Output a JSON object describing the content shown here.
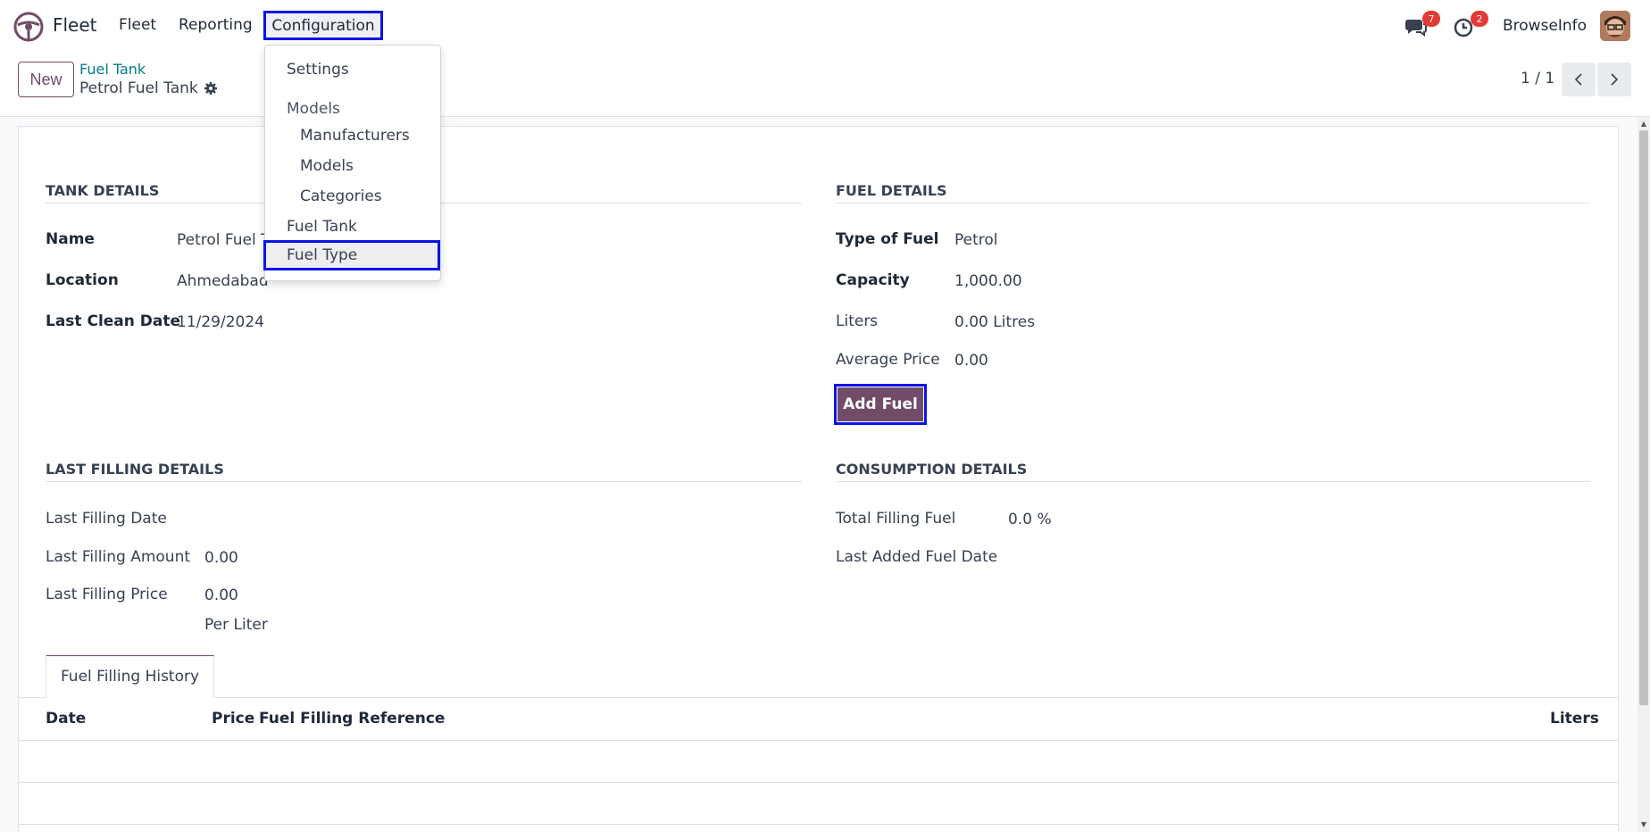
{
  "navbar": {
    "app_name": "Fleet",
    "menu": [
      "Fleet",
      "Reporting",
      "Configuration"
    ],
    "messages_count": "7",
    "activities_count": "2",
    "company": "BrowseInfo"
  },
  "control_panel": {
    "new_label": "New",
    "breadcrumb_parent": "Fuel Tank",
    "breadcrumb_current": "Petrol Fuel Tank",
    "pager": "1 / 1"
  },
  "config_menu": {
    "settings": "Settings",
    "models_header": "Models",
    "manufacturers": "Manufacturers",
    "models": "Models",
    "categories": "Categories",
    "fuel_tank": "Fuel Tank",
    "fuel_type": "Fuel Type"
  },
  "tank_details": {
    "title": "TANK DETAILS",
    "name_label": "Name",
    "name_value": "Petrol Fuel T",
    "location_label": "Location",
    "location_value": "Ahmedabad",
    "clean_label": "Last Clean Date",
    "clean_value": "11/29/2024"
  },
  "fuel_details": {
    "title": "FUEL DETAILS",
    "type_label": "Type of Fuel",
    "type_value": "Petrol",
    "capacity_label": "Capacity",
    "capacity_value": "1,000.00",
    "liters_label": "Liters",
    "liters_value": "0.00 Litres",
    "avg_label": "Average Price",
    "avg_value": "0.00",
    "add_fuel": "Add Fuel"
  },
  "last_filling": {
    "title": "LAST FILLING DETAILS",
    "date_label": "Last Filling Date",
    "amount_label": "Last Filling Amount",
    "amount_value": "0.00",
    "price_label": "Last Filling Price",
    "price_value": "0.00",
    "price_unit": "Per Liter"
  },
  "consumption": {
    "title": "CONSUMPTION DETAILS",
    "total_label": "Total Filling Fuel",
    "total_value": "0.0 %",
    "last_added_label": "Last Added Fuel Date"
  },
  "history": {
    "tab_label": "Fuel Filling History",
    "columns": [
      "Date",
      "Price",
      "Fuel Filling Reference",
      "Liters"
    ]
  },
  "colors": {
    "brand": "#714b67",
    "link": "#017e84",
    "highlight": "#0b13e8",
    "badge": "#e53935"
  }
}
